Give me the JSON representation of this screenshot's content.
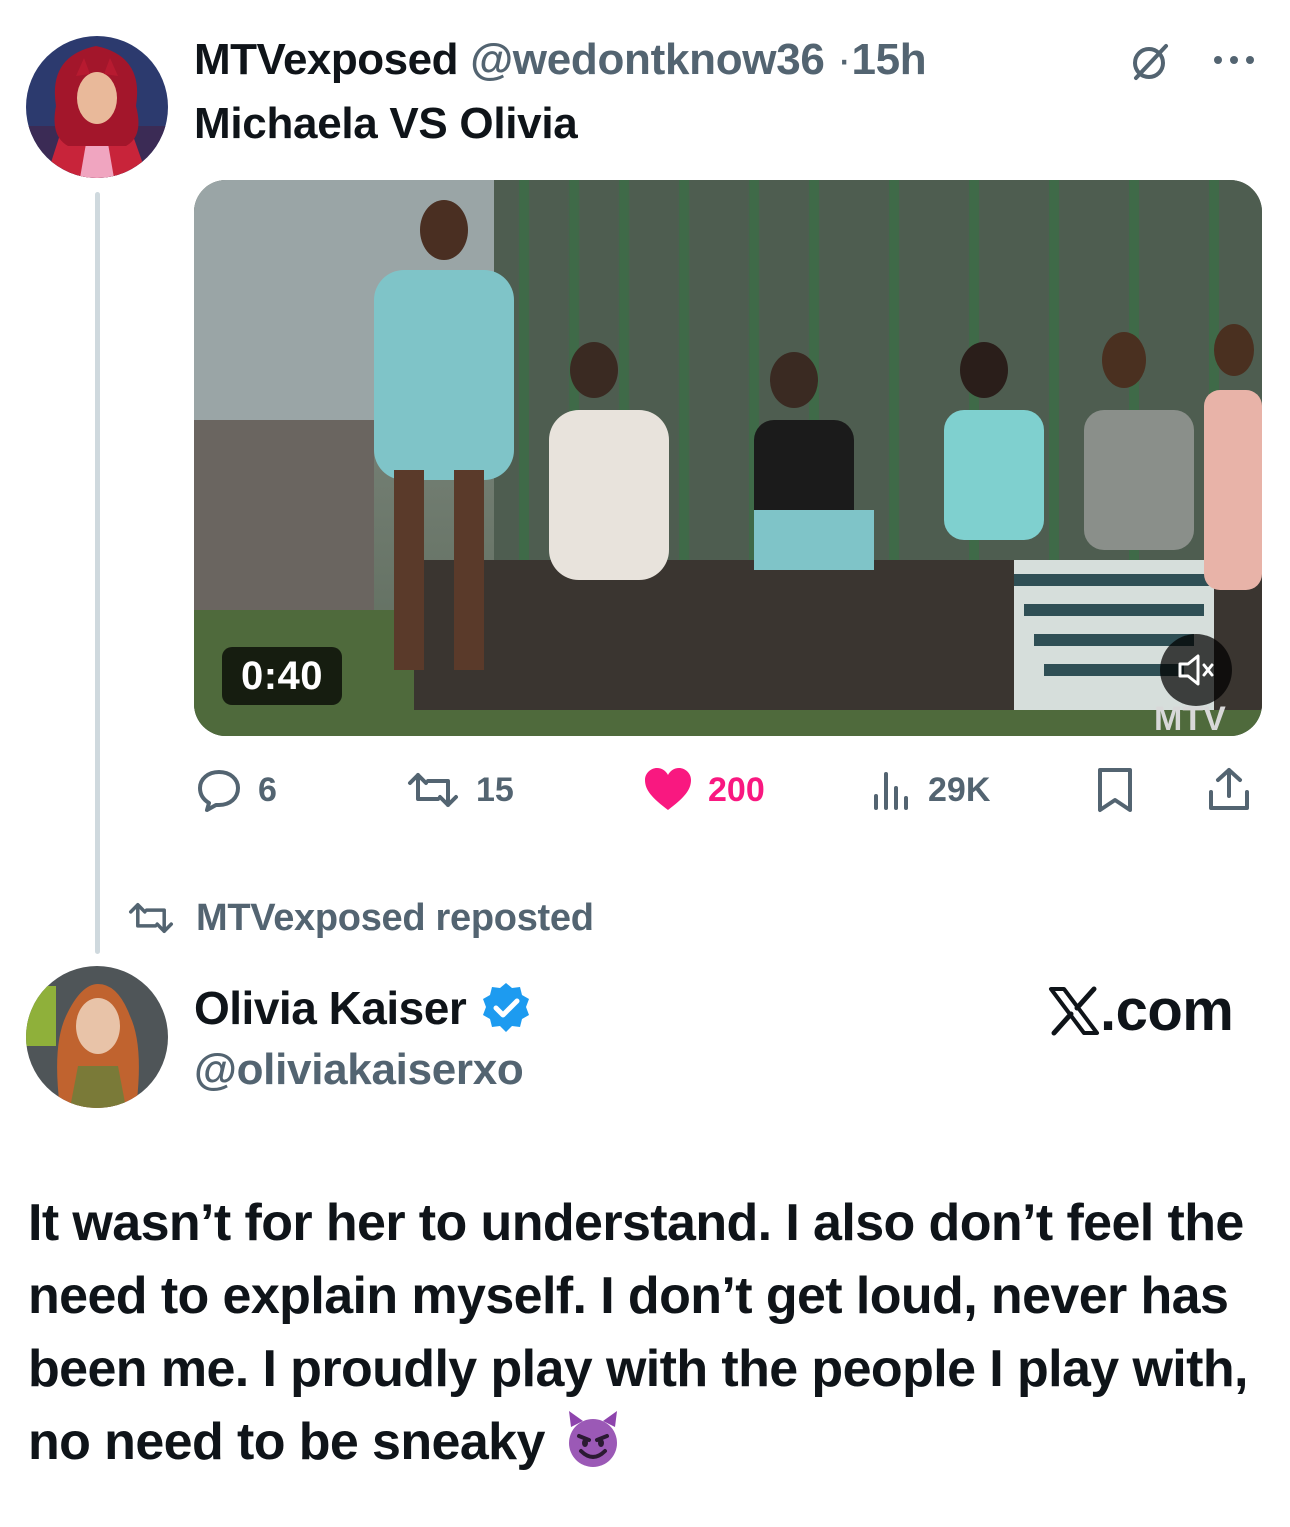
{
  "post1": {
    "display_name": "MTVexposed",
    "handle": "@wedontknow36",
    "dot": "·",
    "time": "15h",
    "text": "Michaela VS Olivia",
    "video": {
      "duration": "0:40",
      "watermark": "MTV"
    },
    "actions": {
      "reply_count": "6",
      "repost_count": "15",
      "like_count": "200",
      "views_count": "29K"
    }
  },
  "repost_context": {
    "label": "MTVexposed reposted"
  },
  "post2": {
    "display_name": "Olivia Kaiser",
    "handle": "@oliviakaiserxo",
    "source": ".com",
    "text": "It wasn’t for her to understand. I also don’t feel the need to explain myself. I don’t get loud, never has been me. I proudly play with the people I play with, no need to be sneaky",
    "emoji": "smiling-devil"
  },
  "colors": {
    "like_pink": "#f91880",
    "verified_blue": "#1d9bf0",
    "muted_gray": "#536471",
    "thread_line": "#cfd9de"
  },
  "icons": [
    "grok-icon",
    "more-icon",
    "reply-icon",
    "repost-icon",
    "heart-icon",
    "views-icon",
    "bookmark-icon",
    "share-icon",
    "mute-icon",
    "verified-badge-icon",
    "x-logo-icon"
  ]
}
